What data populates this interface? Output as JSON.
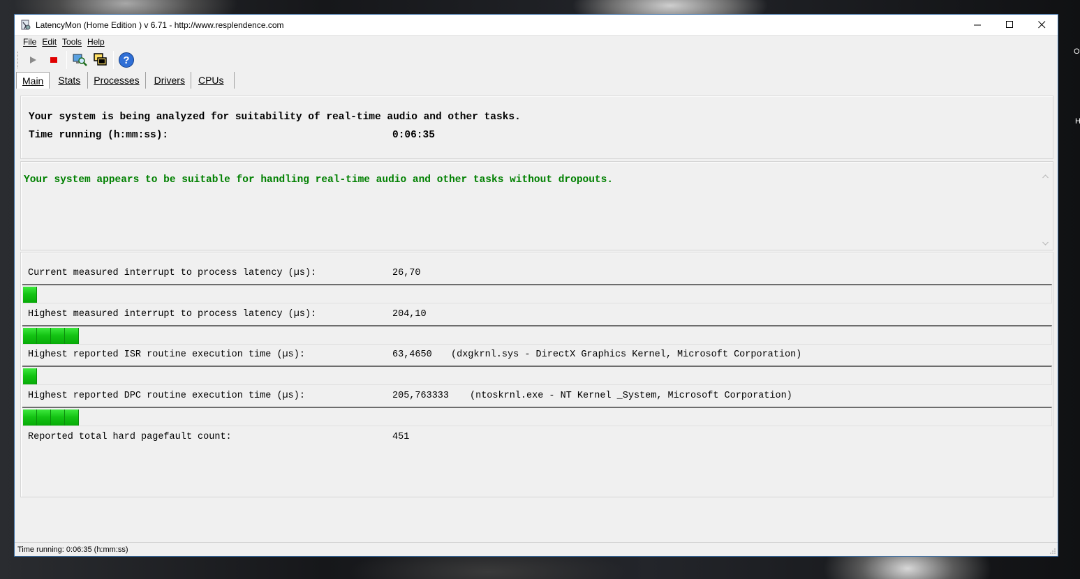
{
  "window": {
    "title": "LatencyMon  (Home Edition )  v 6.71 - http://www.resplendence.com",
    "controls": {
      "minimize": "—",
      "maximize": "☐",
      "close": "✕"
    }
  },
  "desktop": {
    "edge_text_1": "O",
    "edge_text_2": "H"
  },
  "menu": {
    "file": "File",
    "edit": "Edit",
    "tools": "Tools",
    "help": "Help"
  },
  "toolbar": {
    "play_icon": "play-icon",
    "stop_icon": "stop-icon",
    "drivers_icon": "monitor-magnifier-icon",
    "windows_icon": "windows-icon",
    "help_icon": "help-icon",
    "help_glyph": "?"
  },
  "tabs": [
    "Main",
    "Stats",
    "Processes",
    "Drivers",
    "CPUs"
  ],
  "main": {
    "analysis_message": "Your system is being analyzed for suitability of real-time audio and other tasks.",
    "time_running_label": "Time running (h:mm:ss):",
    "time_running_value": "0:06:35",
    "verdict": "Your system appears to be suitable for handling real-time audio and other tasks without dropouts.",
    "verdict_color": "#008000",
    "metrics": [
      {
        "label": "Current measured interrupt to process latency (µs):",
        "value": "26,70",
        "detail": "",
        "level_segments": 1
      },
      {
        "label": "Highest measured interrupt to process latency (µs):",
        "value": "204,10",
        "detail": "",
        "level_segments": 4
      },
      {
        "label": "Highest reported ISR routine execution time (µs):",
        "value": "63,4650",
        "detail": "(dxgkrnl.sys - DirectX Graphics Kernel, Microsoft Corporation)",
        "level_segments": 1
      },
      {
        "label": "Highest reported DPC routine execution time (µs):",
        "value": "205,763333",
        "detail": "(ntoskrnl.exe - NT Kernel _System, Microsoft Corporation)",
        "level_segments": 4
      }
    ],
    "pagefault_label": "Reported total hard pagefault count:",
    "pagefault_value": "451"
  },
  "status": {
    "text": "Time running: 0:06:35  (h:mm:ss)"
  },
  "colors": {
    "meter_green": "#14c414",
    "window_border": "#3a6ea5"
  }
}
